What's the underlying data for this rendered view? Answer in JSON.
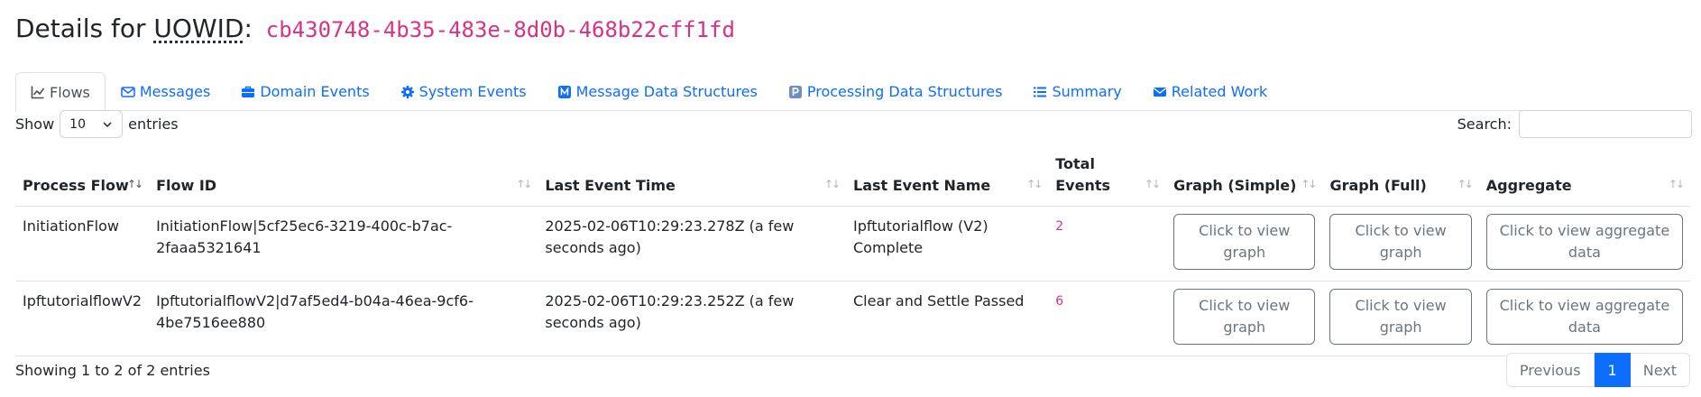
{
  "header": {
    "prefix": "Details for",
    "abbr": "UOWID",
    "colon": ":",
    "uowid_value": "cb430748-4b35-483e-8d0b-468b22cff1fd"
  },
  "tabs": [
    {
      "label": "Flows",
      "icon": "chart-line-icon",
      "active": true
    },
    {
      "label": "Messages",
      "icon": "envelope-icon",
      "active": false
    },
    {
      "label": "Domain Events",
      "icon": "briefcase-icon",
      "active": false
    },
    {
      "label": "System Events",
      "icon": "gear-icon",
      "active": false
    },
    {
      "label": "Message Data Structures",
      "icon": "m-square-icon",
      "active": false
    },
    {
      "label": "Processing Data Structures",
      "icon": "p-square-icon",
      "active": false
    },
    {
      "label": "Summary",
      "icon": "list-icon",
      "active": false
    },
    {
      "label": "Related Work",
      "icon": "envelope-icon",
      "active": false
    }
  ],
  "controls": {
    "show_label": "Show",
    "length_value": "10",
    "entries_label": "entries",
    "search_label": "Search:",
    "search_value": ""
  },
  "table": {
    "columns": [
      "Process Flow",
      "Flow ID",
      "Last Event Time",
      "Last Event Name",
      "Total Events",
      "Graph (Simple)",
      "Graph (Full)",
      "Aggregate"
    ],
    "rows": [
      {
        "process_flow": "InitiationFlow",
        "flow_id": "InitiationFlow|5cf25ec6-3219-400c-b7ac-2faaa5321641",
        "last_event_time": "2025-02-06T10:29:23.278Z (a few seconds ago)",
        "last_event_name": "Ipftutorialflow (V2) Complete",
        "total_events": "2",
        "graph_simple": "Click to view graph",
        "graph_full": "Click to view graph",
        "aggregate": "Click to view aggregate data"
      },
      {
        "process_flow": "IpftutorialflowV2",
        "flow_id": "IpftutorialflowV2|d7af5ed4-b04a-46ea-9cf6-4be7516ee880",
        "last_event_time": "2025-02-06T10:29:23.252Z (a few seconds ago)",
        "last_event_name": "Clear and Settle Passed",
        "total_events": "6",
        "graph_simple": "Click to view graph",
        "graph_full": "Click to view graph",
        "aggregate": "Click to view aggregate data"
      }
    ]
  },
  "footer": {
    "info": "Showing 1 to 2 of 2 entries",
    "previous": "Previous",
    "current_page": "1",
    "next": "Next"
  },
  "colors": {
    "link": "#0d6efd",
    "code": "#d63384",
    "muted": "#6c757d"
  }
}
